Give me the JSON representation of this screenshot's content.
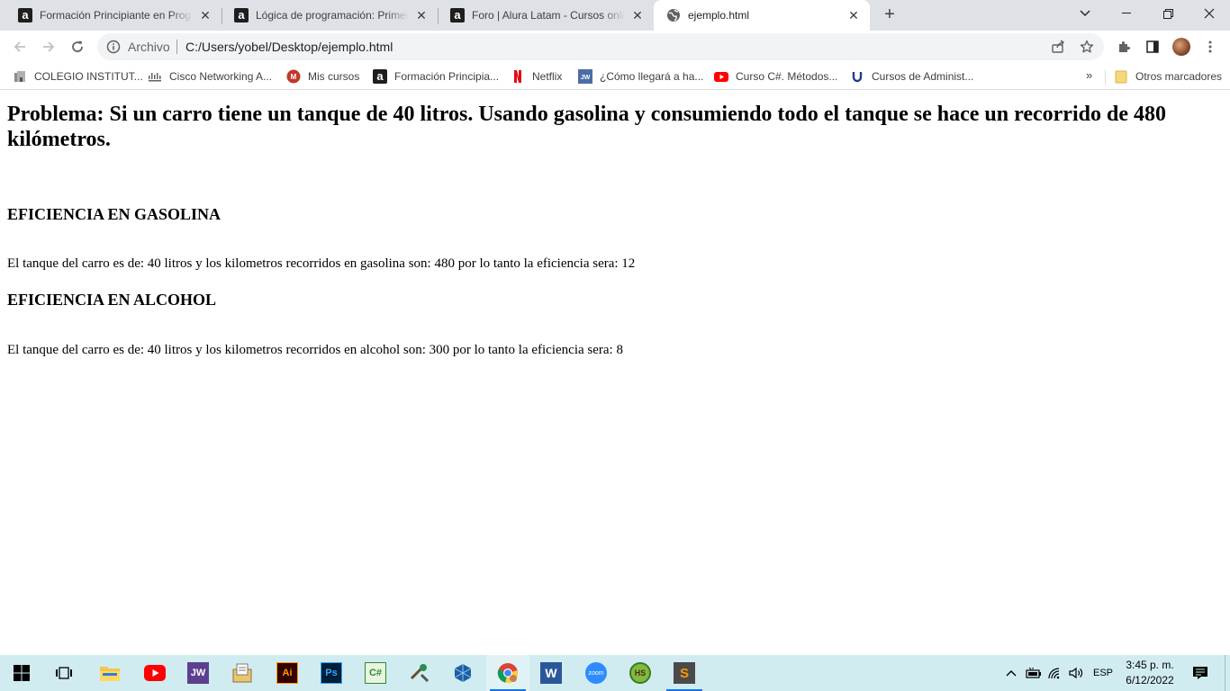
{
  "browser": {
    "tabs": [
      {
        "title": "Formación Principiante en Progra",
        "icon": "alura-icon"
      },
      {
        "title": "Lógica de programación: Primero",
        "icon": "alura-icon"
      },
      {
        "title": "Foro | Alura Latam - Cursos onlin",
        "icon": "alura-icon"
      },
      {
        "title": "ejemplo.html",
        "icon": "globe-icon",
        "active": true
      }
    ],
    "address": {
      "scheme_label": "Archivo",
      "url": "C:/Users/yobel/Desktop/ejemplo.html"
    },
    "bookmarks": [
      {
        "label": "COLEGIO INSTITUT...",
        "icon": "school-icon"
      },
      {
        "label": "Cisco Networking A...",
        "icon": "cisco-icon"
      },
      {
        "label": "Mis cursos",
        "icon": "courses-icon"
      },
      {
        "label": "Formación Principia...",
        "icon": "alura-icon"
      },
      {
        "label": "Netflix",
        "icon": "netflix-icon"
      },
      {
        "label": "¿Cómo llegará a ha...",
        "icon": "jw-icon"
      },
      {
        "label": "Curso C#. Métodos...",
        "icon": "youtube-icon"
      },
      {
        "label": "Cursos de Administ...",
        "icon": "udemy-icon"
      }
    ],
    "bookmarks_more": "»",
    "other_bookmarks": "Otros marcadores"
  },
  "page": {
    "heading": "Problema: Si un carro tiene un tanque de 40 litros. Usando gasolina y consumiendo todo el tanque se hace un recorrido de 480 kilómetros.",
    "sections": [
      {
        "title": "EFICIENCIA EN GASOLINA",
        "text": "El tanque del carro es de: 40 litros y los kilometros recorridos en gasolina son: 480 por lo tanto la eficiencia sera: 12"
      },
      {
        "title": "EFICIENCIA EN ALCOHOL",
        "text": "El tanque del carro es de: 40 litros y los kilometros recorridos en alcohol son: 300 por lo tanto la eficiencia sera: 8"
      }
    ]
  },
  "taskbar": {
    "apps": [
      {
        "name": "file-explorer",
        "label": ""
      },
      {
        "name": "youtube",
        "label": ""
      },
      {
        "name": "jw",
        "label": "JW"
      },
      {
        "name": "notepad-folder",
        "label": ""
      },
      {
        "name": "illustrator",
        "label": "Ai"
      },
      {
        "name": "photoshop",
        "label": "Ps"
      },
      {
        "name": "csharp-ide",
        "label": "C#"
      },
      {
        "name": "tools",
        "label": ""
      },
      {
        "name": "virtualbox",
        "label": ""
      },
      {
        "name": "chrome",
        "label": ""
      },
      {
        "name": "word",
        "label": "W"
      },
      {
        "name": "zoom",
        "label": "zoom"
      },
      {
        "name": "hs-app",
        "label": "HS"
      },
      {
        "name": "sublime-text",
        "label": "S"
      }
    ],
    "tray": {
      "language": "ESP",
      "time": "3:45 p. m.",
      "date": "6/12/2022"
    }
  },
  "colors": {
    "tabstrip_bg": "#dee1e6",
    "omnibox_bg": "#f1f3f4",
    "taskbar_bg": "#d1ecf1",
    "running_indicator": "#1a73e8"
  }
}
